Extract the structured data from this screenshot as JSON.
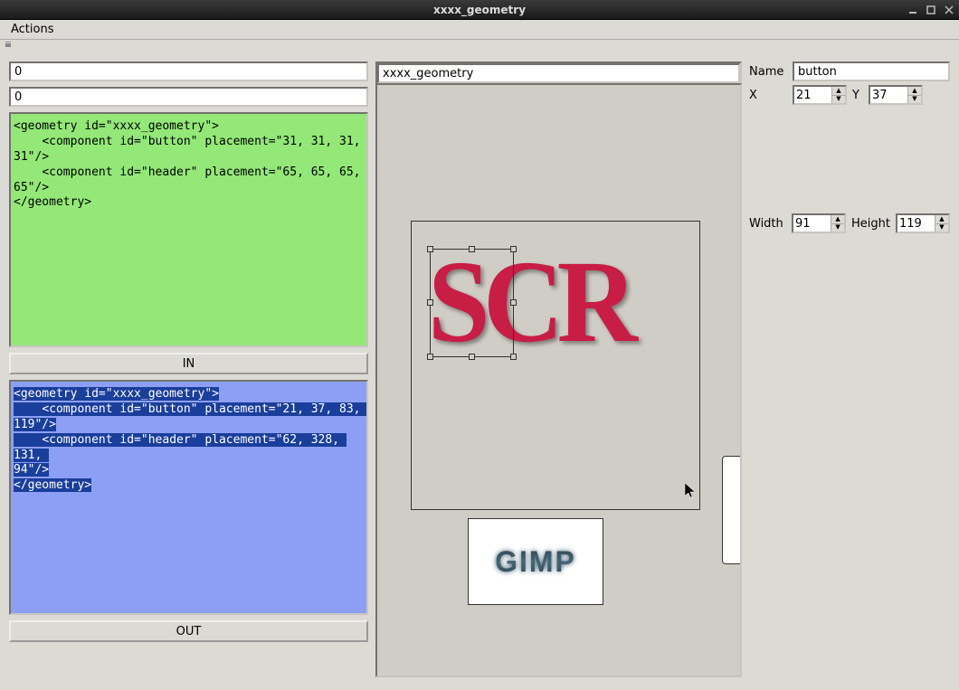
{
  "window": {
    "title": "xxxx_geometry"
  },
  "menu": {
    "actions": "Actions"
  },
  "left": {
    "input1": "0",
    "input2": "0",
    "in_xml": "<geometry id=\"xxxx_geometry\">\n    <component id=\"button\" placement=\"31, 31, 31, 31\"/>\n    <component id=\"header\" placement=\"65, 65, 65, 65\"/>\n</geometry>",
    "in_button": "IN",
    "out_xml_lines": [
      "<geometry id=\"xxxx_geometry\">",
      "    <component id=\"button\" placement=\"21, 37, 83, 119\"/>",
      "    <component id=\"header\" placement=\"62, 328, 131, ",
      "94\"/>",
      "</geometry>"
    ],
    "out_button": "OUT"
  },
  "mid": {
    "title": "xxxx_geometry",
    "big_text": "SCR",
    "thumb_text": "GIMP"
  },
  "props": {
    "name_label": "Name",
    "name_value": "button",
    "x_label": "X",
    "x_value": "21",
    "y_label": "Y",
    "y_value": "37",
    "width_label": "Width",
    "width_value": "91",
    "height_label": "Height",
    "height_value": "119"
  }
}
